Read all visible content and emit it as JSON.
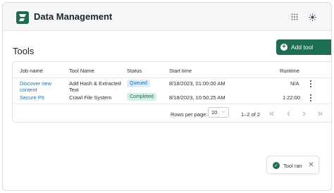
{
  "app": {
    "title": "Data Management",
    "brand_color": "#1e6d52"
  },
  "header": {
    "apps_icon": "grid-icon",
    "theme_icon": "sun-icon"
  },
  "page": {
    "section_title": "Tools",
    "add_button_label": "Add tool"
  },
  "table": {
    "columns": [
      "Job name",
      "Tool Name",
      "Status",
      "Start time",
      "Runtime"
    ],
    "rows": [
      {
        "job_name": "Discover new content",
        "tool_name": "Add Hash & Extracted Text",
        "status": "Queued",
        "start_time": "8/18/2023, 01:00:00 AM",
        "runtime": "N/A"
      },
      {
        "job_name": "Secure PII",
        "tool_name": "Crawl File System",
        "status": "Completed",
        "start_time": "8/18/2023, 10:50:25 AM",
        "runtime": "1:22:00"
      }
    ]
  },
  "pagination": {
    "rows_per_page_label": "Rows per page:",
    "rows_per_page_value": "10",
    "range_text": "1–2 of 2"
  },
  "toast": {
    "message": "Tool ran"
  }
}
